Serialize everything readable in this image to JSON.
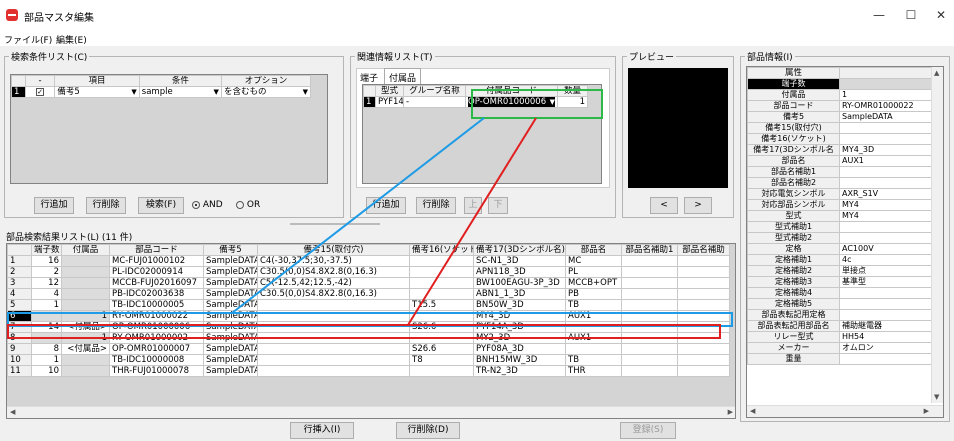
{
  "window": {
    "title": "部品マスタ編集",
    "controls": [
      "—",
      "☐",
      "✕"
    ]
  },
  "menu": [
    "ファイル(F)",
    "編集(E)"
  ],
  "search": {
    "legend": "検索条件リスト(C)",
    "headers": [
      "-",
      "項目",
      "条件",
      "オプション"
    ],
    "row": {
      "num": "1",
      "checked": true,
      "item": "備考5",
      "value": "sample",
      "option": "を含むもの"
    },
    "add_label": "行追加",
    "delete_label": "行削除",
    "search_label": "検索(F)",
    "and_label": "AND",
    "or_label": "OR",
    "logic": "AND"
  },
  "related": {
    "legend": "関連情報リスト(T)",
    "tabs": [
      "端子",
      "付属品"
    ],
    "active_tab": "付属品",
    "headers": [
      "型式",
      "グループ名称",
      "付属品コード",
      "数量"
    ],
    "row": {
      "num": "1",
      "model": "PYF14A",
      "group": "-",
      "code": "OP-OMR01000006",
      "qty": "1"
    },
    "add_label": "行追加",
    "delete_label": "行削除",
    "up_label": "上",
    "down_label": "下"
  },
  "preview": {
    "legend": "プレビュー",
    "prev_label": "<",
    "next_label": ">"
  },
  "results": {
    "legend": "部品検索結果リスト(L)  (11 件)",
    "headers": [
      "",
      "端子数",
      "付属品",
      "部品コード",
      "備考5",
      "備考15(取付穴)",
      "備考16(ソケット)",
      "備考17(3Dシンボル名)",
      "部品名",
      "部品名補助1",
      "部品名補助"
    ],
    "rows": [
      [
        "1",
        "16",
        "",
        "MC-FUJ01000102",
        "SampleDATA",
        "C4(-30,37.5;30,-37.5)",
        "",
        "SC-N1_3D",
        "MC",
        "",
        ""
      ],
      [
        "2",
        "2",
        "",
        "PL-IDC02000914",
        "SampleDATA",
        "C30.5(0,0)S4.8X2.8(0,16.3)",
        "",
        "APN118_3D",
        "PL",
        "",
        ""
      ],
      [
        "3",
        "12",
        "",
        "MCCB-FUJ02016097",
        "SampleDATA",
        "C5(-12.5,42;12.5,-42)",
        "",
        "BW100EAGU-3P_3D",
        "MCCB+OPT",
        "",
        ""
      ],
      [
        "4",
        "4",
        "",
        "PB-IDC02003638",
        "SampleDATA",
        "C30.5(0,0)S4.8X2.8(0,16.3)",
        "",
        "ABN1_1_3D",
        "PB",
        "",
        ""
      ],
      [
        "5",
        "1",
        "",
        "TB-IDC10000005",
        "SampleDATA",
        "",
        "T15.5",
        "BN50W_3D",
        "TB",
        "",
        ""
      ],
      [
        "6",
        "",
        "1",
        "RY-OMR01000022",
        "SampleDATA",
        "",
        "",
        "MY4_3D",
        "AUX1",
        "",
        ""
      ],
      [
        "7",
        "14",
        "<付属品>",
        "OP-OMR01000006",
        "SampleDATA",
        "",
        "S26.6",
        "PYF14A_3D",
        "",
        "",
        ""
      ],
      [
        "8",
        "",
        "1",
        "RY-OMR01000002",
        "SampleDATA",
        "",
        "",
        "MY2_3D",
        "AUX1",
        "",
        ""
      ],
      [
        "9",
        "8",
        "<付属品>",
        "OP-OMR01000007",
        "SampleDATA",
        "",
        "S26.6",
        "PYF08A_3D",
        "",
        "",
        ""
      ],
      [
        "10",
        "1",
        "",
        "TB-IDC10000008",
        "SampleDATA",
        "",
        "T8",
        "BNH15MW_3D",
        "TB",
        "",
        ""
      ],
      [
        "11",
        "10",
        "",
        "THR-FUJ01000078",
        "SampleDATA",
        "",
        "",
        "TR-N2_3D",
        "THR",
        "",
        ""
      ]
    ]
  },
  "info": {
    "legend": "部品情報(I)",
    "headers": [
      "属性",
      ""
    ],
    "rows": [
      [
        "端子数",
        ""
      ],
      [
        "付属品",
        "1"
      ],
      [
        "部品コード",
        "RY-OMR01000022"
      ],
      [
        "備考5",
        "SampleDATA"
      ],
      [
        "備考15(取付穴)",
        ""
      ],
      [
        "備考16(ソケット)",
        ""
      ],
      [
        "備考17(3Dシンボル名",
        "MY4_3D"
      ],
      [
        "部品名",
        "AUX1"
      ],
      [
        "部品名補助1",
        ""
      ],
      [
        "部品名補助2",
        ""
      ],
      [
        "対応電気シンボル",
        "AXR_S1V"
      ],
      [
        "対応部品シンボル",
        "MY4"
      ],
      [
        "型式",
        "MY4"
      ],
      [
        "型式補助1",
        ""
      ],
      [
        "型式補助2",
        ""
      ],
      [
        "定格",
        "AC100V"
      ],
      [
        "定格補助1",
        "4c"
      ],
      [
        "定格補助2",
        "単接点"
      ],
      [
        "定格補助3",
        "基準型"
      ],
      [
        "定格補助4",
        ""
      ],
      [
        "定格補助5",
        ""
      ],
      [
        "部品表転記用定格",
        ""
      ],
      [
        "部品表転記用部品名",
        "補助継電器"
      ],
      [
        "リレー型式",
        "HH54"
      ],
      [
        "メーカー",
        "オムロン"
      ],
      [
        "重量",
        ""
      ]
    ]
  },
  "bottom": {
    "insert_label": "行挿入(I)",
    "delete_label": "行削除(D)",
    "register_label": "登録(S)"
  },
  "colors": {
    "blue_highlight": "#1e9be6",
    "red_highlight": "#e02020",
    "green_highlight": "#2db84a"
  }
}
